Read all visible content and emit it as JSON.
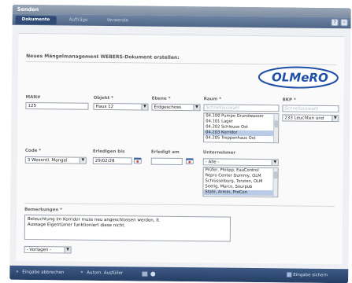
{
  "window": {
    "title": "Senden"
  },
  "tabs": [
    {
      "label": "Dokumente",
      "active": true
    },
    {
      "label": "Aufträge",
      "active": false
    },
    {
      "label": "Verwende",
      "active": false
    }
  ],
  "form": {
    "heading": "Neues Mängelmanagement WEBERS-Dokument erstellen:",
    "logo_text": "OLMeRO",
    "man": {
      "label": "MAN#",
      "value": "125"
    },
    "objekt": {
      "label": "Objekt *",
      "value": "Haus 12"
    },
    "ebene": {
      "label": "Ebene *",
      "value": "Erdgeschoss"
    },
    "raum": {
      "label": "Raum *",
      "placeholder": "Schnellauswahl",
      "items": [
        "04.100 Pumpe Grundwasser",
        "04.101 Lager",
        "04.202 Schleuse Ost",
        "04.203 Korridor",
        "04.205 Treppenhaus Ost"
      ],
      "selected_index": 3
    },
    "bkp": {
      "label": "BKP *",
      "placeholder": "Schnellauswahl",
      "value": "233 Leuchten und"
    },
    "code": {
      "label": "Code *",
      "value": "3 Wesentl. Mangel"
    },
    "erledigen_bis": {
      "label": "Erledigen bis",
      "value": "29/02/28"
    },
    "erledigt_am": {
      "label": "Erledigt am",
      "value": ""
    },
    "unternehmer": {
      "label": "Unternehmer",
      "value": "- Alle -",
      "items": [
        "Prüfer, Philipp, EauControl",
        "Repro Center Dummy, OLM",
        "Schlüsselburg, Torsten, OLM",
        "Seelig, Marco, Sourpub",
        "Stahl, Armin, PreCon"
      ],
      "selected_index": 4
    },
    "bemerkungen": {
      "label": "Bemerkungen *",
      "lines": [
        "Beleuchtung im Korridor muss neu angeschlossen werden, lt.",
        "Aussage Eigentümer funktioniert diese nicht."
      ]
    },
    "vorlagen": {
      "value": "- Vorlagen -"
    }
  },
  "bottom": {
    "cancel": "Eingabe abbrechen",
    "autotext": "Autom. Ausfüller",
    "save": "Eingabe sichern"
  },
  "colors": {
    "accent": "#2f4a74",
    "selection": "#b9cbe6",
    "logo_blue": "#1f4fa6"
  }
}
